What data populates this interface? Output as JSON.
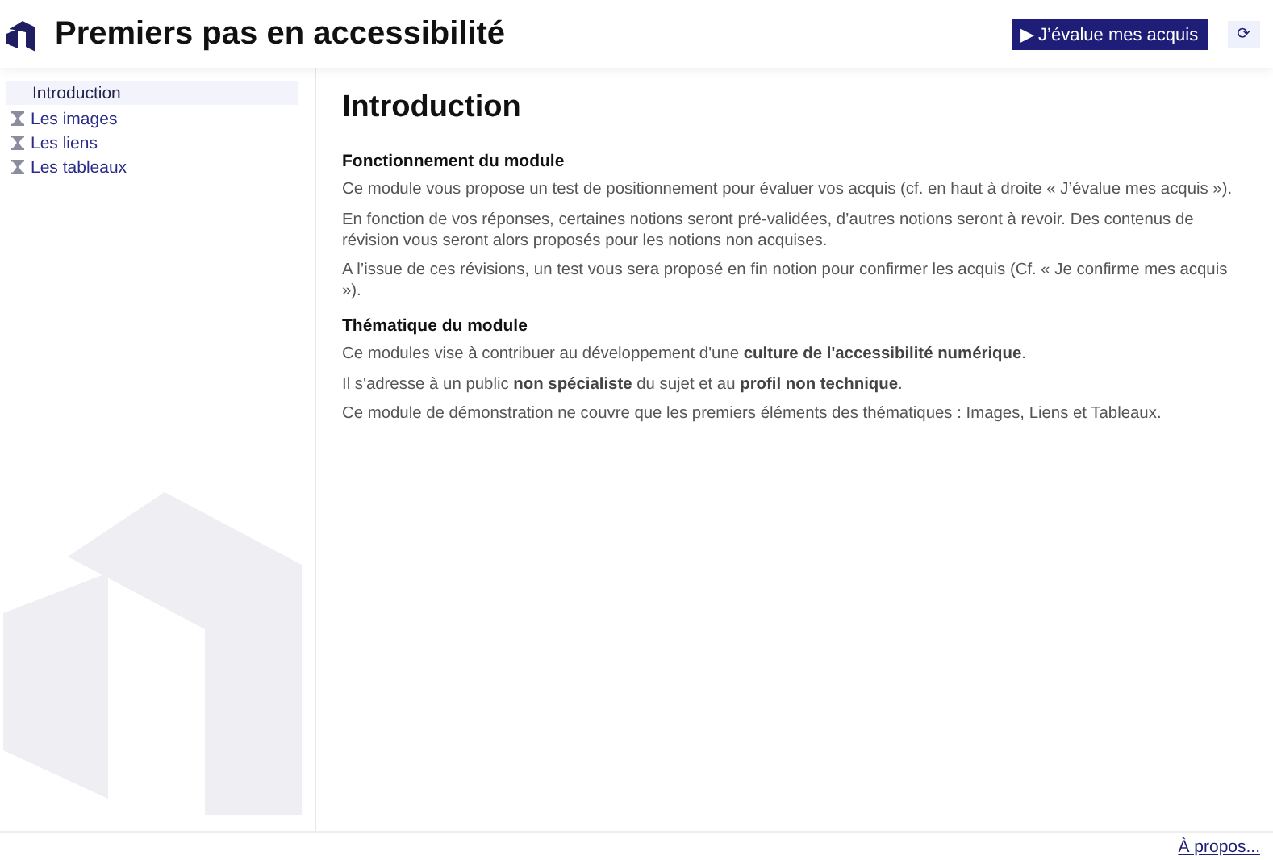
{
  "header": {
    "title": "Premiers pas en accessibilité",
    "evaluate_button": "▶ J’évalue mes acquis",
    "reset_button": "⟳"
  },
  "sidebar": {
    "items": [
      {
        "label": "Introduction",
        "selected": true,
        "pending": false
      },
      {
        "label": "Les images",
        "selected": false,
        "pending": true
      },
      {
        "label": "Les liens",
        "selected": false,
        "pending": true
      },
      {
        "label": "Les tableaux",
        "selected": false,
        "pending": true
      }
    ]
  },
  "content": {
    "title": "Introduction",
    "sections": [
      {
        "heading": "Fonctionnement du module",
        "paragraphs": [
          "Ce module vous propose un test de positionnement pour évaluer vos acquis (cf. en haut à droite «  J’évalue mes acquis »).",
          "En fonction de vos réponses, certaines notions seront pré-validées, d’autres notions seront à revoir. Des contenus de révision vous seront alors proposés pour les notions non acquises.",
          "A l’issue de ces révisions, un test vous sera proposé en fin notion pour confirmer les acquis (Cf. « Je confirme mes acquis »)."
        ]
      },
      {
        "heading": "Thématique du module",
        "paragraphs": [
          "Ce modules vise à contribuer au développement d'une **culture de l'accessibilité numérique**.",
          "Il s'adresse à un public **non spécialiste** du sujet et au **profil non technique**.",
          "Ce module de démonstration ne couvre que les premiers éléments des thématiques : Images, Liens et Tableaux."
        ]
      }
    ]
  },
  "footer": {
    "link": "À propos..."
  }
}
